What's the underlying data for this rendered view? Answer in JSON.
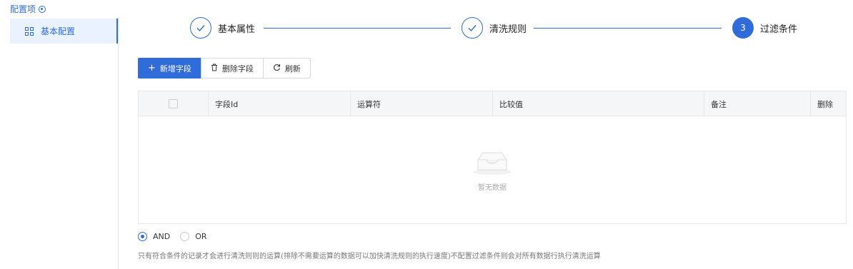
{
  "sidebar": {
    "title": "配置项",
    "items": [
      {
        "label": "基本配置",
        "icon": "grid-icon",
        "active": true
      }
    ]
  },
  "steps": [
    {
      "label": "基本属性",
      "status": "done"
    },
    {
      "label": "清洗规则",
      "status": "done"
    },
    {
      "label": "过滤条件",
      "status": "active",
      "number": "3"
    }
  ],
  "colors": {
    "accent": "#2f6bd9",
    "header_bg": "#f5f6f8",
    "border": "#e8e8e8"
  },
  "toolbar": {
    "add_label": "新增字段",
    "delete_label": "删除字段",
    "refresh_label": "刷新"
  },
  "table": {
    "columns": [
      "字段Id",
      "运算符",
      "比较值",
      "备注",
      "删除"
    ],
    "empty_text": "暂无数据"
  },
  "logic": {
    "options": [
      "AND",
      "OR"
    ],
    "selected": "AND"
  },
  "hint": "只有符合条件的记录才会进行清洗则则的运算(排除不需要运算的数据可以加快清洗规则的执行速度)不配置过滤条件则会对所有数据行执行清洗运算"
}
